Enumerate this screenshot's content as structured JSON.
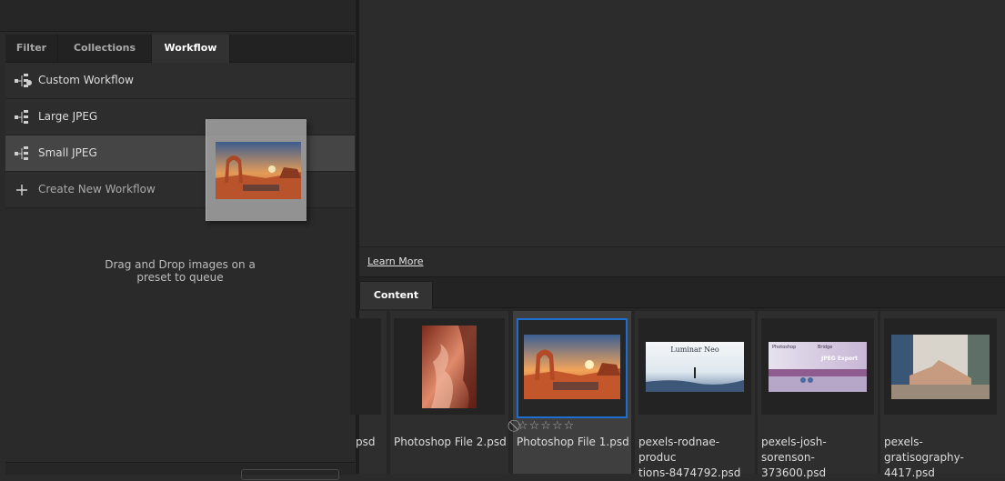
{
  "tabs": [
    "Filter",
    "Collections",
    "Workflow"
  ],
  "active_tab": "Workflow",
  "workflows": [
    {
      "label": "Custom Workflow",
      "icon": "workflow-icon"
    },
    {
      "label": "Large JPEG",
      "icon": "workflow-icon"
    },
    {
      "label": "Small JPEG",
      "icon": "workflow-icon",
      "selected": true
    }
  ],
  "create_new": {
    "label": "Create New Workflow",
    "icon": "plus-icon"
  },
  "drop_hint": {
    "line1": "Drag and Drop images on a",
    "line2": "preset to queue"
  },
  "learn_more": "Learn More",
  "content_tab": "Content",
  "content_items": [
    {
      "name": "psd",
      "thumb": "partial"
    },
    {
      "name": "Photoshop File 2.psd",
      "thumb": "antelope-canyon"
    },
    {
      "name": "Photoshop File 1.psd",
      "thumb": "delicate-arch",
      "selected": true,
      "rating_text": "⃠☆☆☆☆☆"
    },
    {
      "name": "pexels-rodnae-productions-8474792.psd",
      "line1": "pexels-rodnae-produc",
      "line2": "tions-8474792.psd",
      "thumb": "luminar-neo",
      "thumb_text": "Luminar Neo"
    },
    {
      "name": "pexels-josh-sorenson-373600.psd",
      "line1": "pexels-josh-sorenson-",
      "line2": "373600.psd",
      "thumb": "photoshop-bridge",
      "thumb_text1": "Photoshop",
      "thumb_text2": "Bridge",
      "thumb_text3": "JPEG Export"
    },
    {
      "name": "pexels-gratisography-4417.psd",
      "line1": "pexels-gratisography-",
      "line2": "4417.psd",
      "thumb": "arm-wrestling"
    }
  ],
  "colors": {
    "selection_blue": "#1c6fd1",
    "panel_bg": "#2b2b2b",
    "selected_row": "#454545"
  }
}
